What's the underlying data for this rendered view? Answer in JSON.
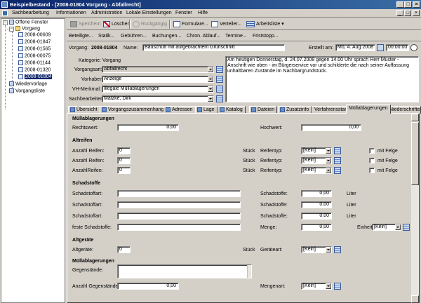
{
  "window": {
    "title": "Beispielbestand - [2008-01804 Vorgang - Abfallrecht]"
  },
  "menu": [
    "Sachbearbeitung",
    "Informationen",
    "Administration",
    "Lokale Einstellungen",
    "Fenster",
    "Hilfe"
  ],
  "tree": {
    "root": "Offene Fenster",
    "vorgang": "Vorgang",
    "items": [
      "2008-00609",
      "2008-01847",
      "2008-01565",
      "2008-00075",
      "2008-01144",
      "2008-01320",
      "2008-01804"
    ],
    "wiedervorlage": "Wiedervorlage",
    "vorgangsliste": "Vorgangsliste"
  },
  "toolbar": {
    "speichern": "Speichern",
    "loeschen": "Löschen",
    "rueckgaengig": "Rückgängig",
    "formulare": "Formulare...",
    "verteiler": "Verteiler...",
    "arbeitsliste": "Arbeitsliste"
  },
  "nav": [
    "Beteiligte...",
    "Statik...",
    "Gebühren...",
    "Buchungen...",
    "Chron. Ablauf...",
    "Termine...",
    "Friststopp..."
  ],
  "header": {
    "vorgang_label": "Vorgang:",
    "vorgang_nr": "2008-01804",
    "name_label": "Name:",
    "name_value": "Bauschutt mit aufgebrachtem Grünschnitt",
    "erstellt_label": "Erstellt am:",
    "erstellt_date": "Mo, 4. Aug 2008",
    "erstellt_time": "00:00:00"
  },
  "details": {
    "kategorie_label": "Kategorie:",
    "kategorie_value": "Vorgang",
    "vorgangsart_label": "Vorgangsart:",
    "vorgangsart_value": "Abfallrecht",
    "vorhaben_label": "Vorhaben:",
    "vorhaben_value": "Anzeige",
    "vh_label": "VH-Merkmal:",
    "vh_value": "illegale Müllablagerungen",
    "sachbearbeiter_label": "Sachbearbeiter:",
    "sachbearbeiter_value": "Matzke, Dirk",
    "notes": "Am heutigen Donnerstag, d. 24.07.2008 gegen 14.00 Uhr sprach Herr Muster - Anschrift wie oben - im Bürgerservice vor und schilderte die nach seiner Auffassung unhaltbaren Zustände im Nachbargrundstück."
  },
  "tabs": [
    "Übersicht",
    "Vorgangszusammenhang",
    "Adressen",
    "Lage",
    "Katalog",
    "Dateien",
    "Zusatzinfo",
    "Verfahrensstand",
    "Müllablagerungen",
    "Niederschriften"
  ],
  "active_tab": "Müllablagerungen",
  "form": {
    "muell": {
      "title": "Müllablagerungen",
      "rechtswert_label": "Rechtswert:",
      "rechtswert": "0,00",
      "hochwert_label": "Hochwert:",
      "hochwert": "0,00"
    },
    "altreifen": {
      "title": "Altreifen",
      "rows": [
        {
          "label": "Anzahl Reifen:",
          "value": "0",
          "unit": "Stück",
          "typ_label": "Reifentyp:",
          "typ": "[Kein]",
          "felge": "mit Felge"
        },
        {
          "label": "Anzahl Reifen:",
          "value": "0",
          "unit": "Stück",
          "typ_label": "Reifentyp:",
          "typ": "[Kein]",
          "felge": "mit Felge"
        },
        {
          "label": "AnzahlReifen:",
          "value": "0",
          "unit": "Stück",
          "typ_label": "Reifentyp:",
          "typ": "[Kein]",
          "felge": "mit Felge"
        }
      ]
    },
    "schadstoffe": {
      "title": "Schadstoffe",
      "rows": [
        {
          "label": "Schadstoffart:",
          "menge_label": "Schadstoffe:",
          "menge": "0,00",
          "unit": "Liter"
        },
        {
          "label": "Schadstoffart:",
          "menge_label": "Schadstoffe:",
          "menge": "0,00",
          "unit": "Liter"
        },
        {
          "label": "Schadstoffart:",
          "menge_label": "Schadstoffe:",
          "menge": "0,00",
          "unit": "Liter"
        },
        {
          "label": "feste Schadstoffe:",
          "menge_label": "Menge:",
          "menge": "0,00",
          "unit": "Einheit",
          "einheit": "[Kein]"
        }
      ]
    },
    "altgeraete": {
      "title": "Altgeräte",
      "label": "Altgeräte:",
      "value": "0",
      "unit": "Stück",
      "art_label": "Geräteart:",
      "art": "[Kein]"
    },
    "muell2": {
      "title": "Müllablagerungen",
      "gegenstaende_label": "Gegenstände:",
      "anzahl_label": "Anzahl Gegenstände:",
      "anzahl": "0,00",
      "mengenart_label": "Mengenart:",
      "mengenart": "[Kein]"
    }
  },
  "colors": {
    "titlebar": "#0a246a",
    "face": "#d4d0c8",
    "selection": "#0a246a"
  }
}
